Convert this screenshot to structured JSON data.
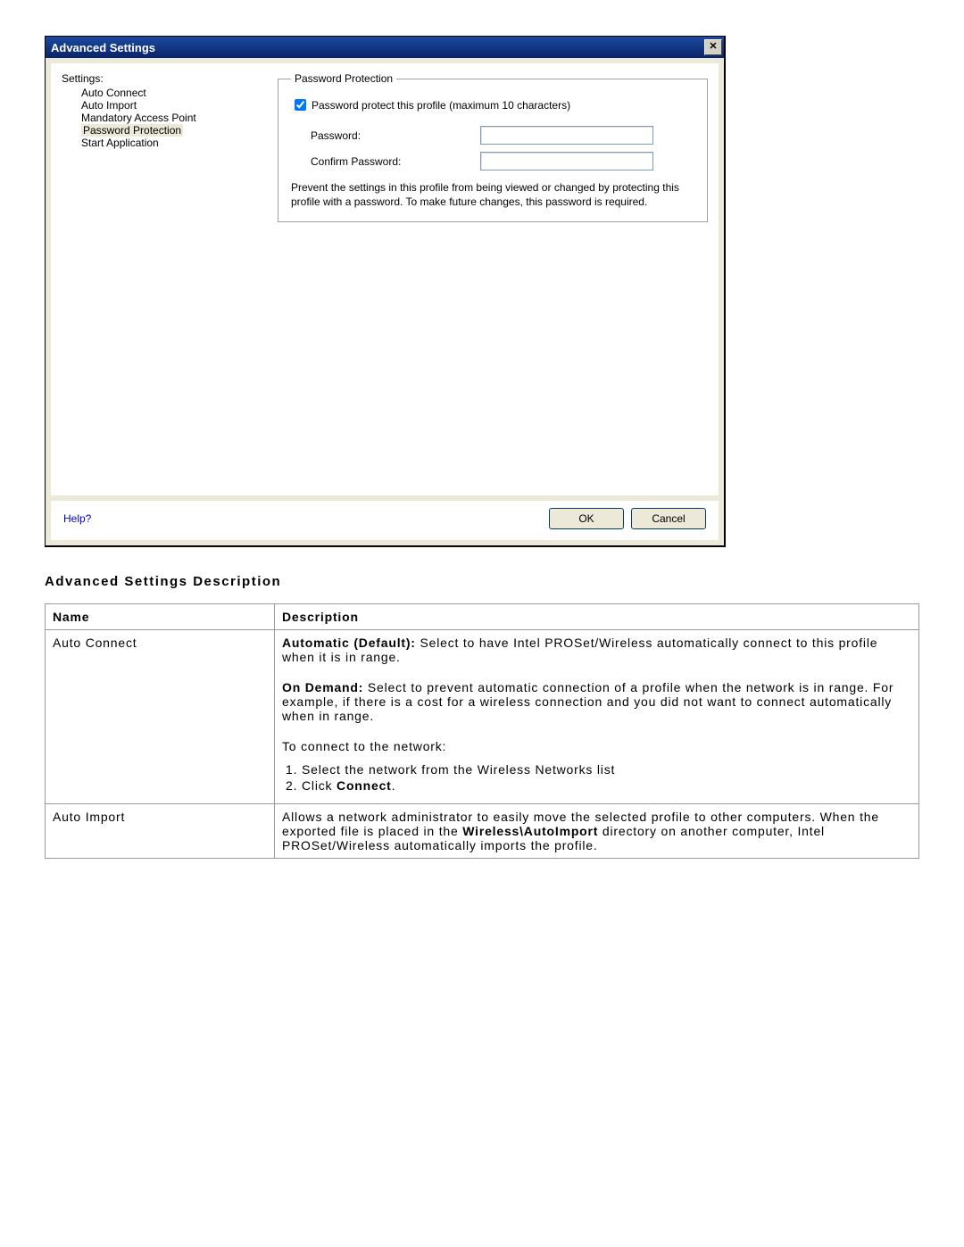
{
  "dialog": {
    "title": "Advanced Settings",
    "close_symbol": "✕",
    "settings_label": "Settings:",
    "items": {
      "0": "Auto Connect",
      "1": "Auto Import",
      "2": "Mandatory Access Point",
      "3": "Password Protection",
      "4": "Start Application"
    },
    "group": {
      "legend": "Password Protection",
      "checkbox_label": "Password protect this profile (maximum 10 characters)",
      "password_label": "Password:",
      "confirm_label": "Confirm Password:",
      "description": "Prevent the settings in this profile from being viewed or changed by protecting this profile with a password. To make future changes, this password is required."
    },
    "footer": {
      "help": "Help?",
      "ok": "OK",
      "cancel": "Cancel"
    }
  },
  "doc": {
    "heading": "Advanced Settings Description",
    "headers": {
      "name": "Name",
      "desc": "Description"
    },
    "rows": {
      "auto_connect": {
        "name": "Auto Connect",
        "automatic_label": "Automatic (Default):",
        "automatic_text": " Select to have Intel PROSet/Wireless automatically connect to this profile when it is in range.",
        "ondemand_label": "On Demand:",
        "ondemand_text": " Select to prevent automatic connection of a profile when the network is in range. For example, if there is a cost for a wireless connection and you did not want to connect automatically when in range.",
        "connect_heading": "To connect to the network:",
        "step1": "Select the network from the Wireless Networks list",
        "step2_pre": "Click ",
        "step2_b": "Connect",
        "step2_post": "."
      },
      "auto_import": {
        "name": "Auto Import",
        "p1": "Allows a network administrator to easily move the selected profile to other computers. When the exported file is placed in the ",
        "p1b": "Wireless\\AutoImport",
        "p2": " directory on another computer, Intel PROSet/Wireless automatically imports the profile."
      }
    }
  }
}
